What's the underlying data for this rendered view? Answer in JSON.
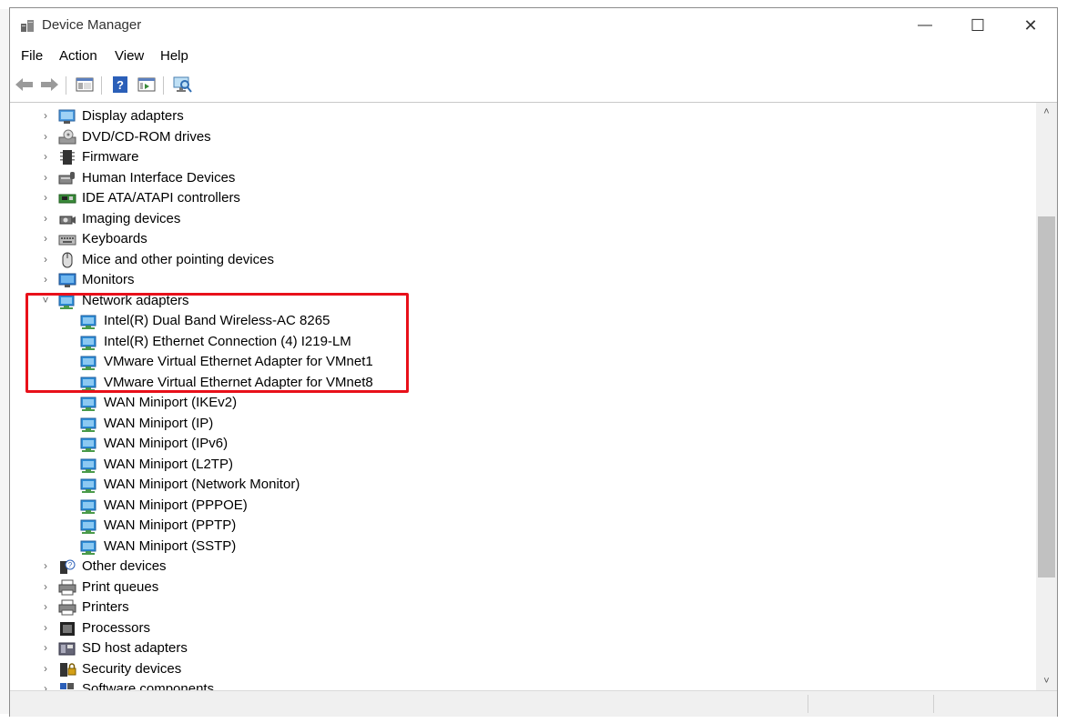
{
  "window": {
    "title": "Device Manager",
    "minimize_glyph": "—",
    "maximize_glyph": "☐",
    "close_glyph": "✕"
  },
  "menu": [
    "File",
    "Action",
    "View",
    "Help"
  ],
  "toolbar": {
    "buttons": [
      "back-icon",
      "forward-icon",
      "show-hide-console-tree-icon",
      "help-icon",
      "properties-icon",
      "scan-hardware-icon"
    ]
  },
  "tree": {
    "categories_before": [
      {
        "label": "Display adapters",
        "icon": "display-adapter-icon"
      },
      {
        "label": "DVD/CD-ROM drives",
        "icon": "dvd-drive-icon"
      },
      {
        "label": "Firmware",
        "icon": "firmware-icon"
      },
      {
        "label": "Human Interface Devices",
        "icon": "hid-icon"
      },
      {
        "label": "IDE ATA/ATAPI controllers",
        "icon": "ide-controller-icon"
      },
      {
        "label": "Imaging devices",
        "icon": "camera-icon"
      },
      {
        "label": "Keyboards",
        "icon": "keyboard-icon"
      },
      {
        "label": "Mice and other pointing devices",
        "icon": "mouse-icon"
      },
      {
        "label": "Monitors",
        "icon": "monitor-icon"
      }
    ],
    "expanded": {
      "label": "Network adapters",
      "icon": "network-adapter-icon",
      "children": [
        "Intel(R) Dual Band Wireless-AC 8265",
        "Intel(R) Ethernet Connection (4) I219-LM",
        "VMware Virtual Ethernet Adapter for VMnet1",
        "VMware Virtual Ethernet Adapter for VMnet8",
        "WAN Miniport (IKEv2)",
        "WAN Miniport (IP)",
        "WAN Miniport (IPv6)",
        "WAN Miniport (L2TP)",
        "WAN Miniport (Network Monitor)",
        "WAN Miniport (PPPOE)",
        "WAN Miniport (PPTP)",
        "WAN Miniport (SSTP)"
      ]
    },
    "categories_after": [
      {
        "label": "Other devices",
        "icon": "unknown-device-icon"
      },
      {
        "label": "Print queues",
        "icon": "printer-icon"
      },
      {
        "label": "Printers",
        "icon": "printer-icon"
      },
      {
        "label": "Processors",
        "icon": "processor-icon"
      },
      {
        "label": "SD host adapters",
        "icon": "sd-host-icon"
      },
      {
        "label": "Security devices",
        "icon": "security-device-icon"
      },
      {
        "label": "Software components",
        "icon": "software-component-icon"
      }
    ]
  },
  "annotation": {
    "color": "#e8101a"
  },
  "colors": {
    "network_blue": "#2f8fd8",
    "chevron": "#666666"
  }
}
